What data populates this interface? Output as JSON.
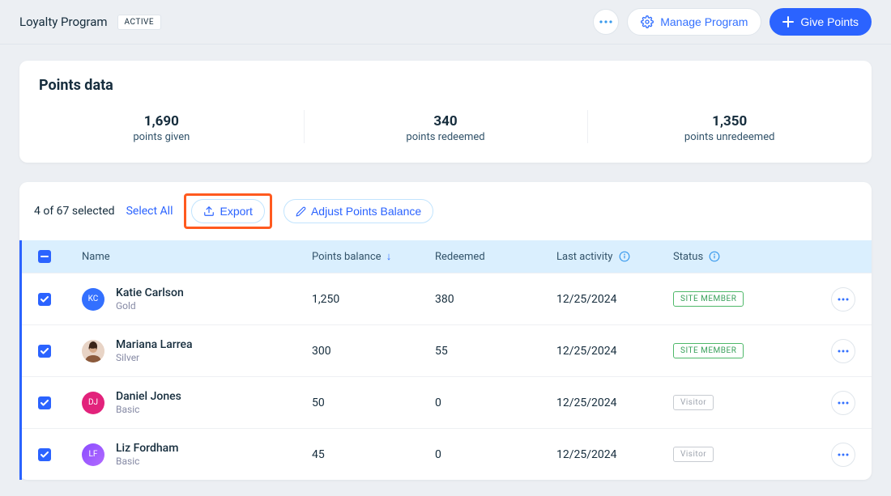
{
  "header": {
    "title": "Loyalty Program",
    "status_badge": "ACTIVE",
    "manage_button": "Manage Program",
    "give_button": "Give Points"
  },
  "summary": {
    "title": "Points data",
    "stats": [
      {
        "value": "1,690",
        "label": "points given"
      },
      {
        "value": "340",
        "label": "points redeemed"
      },
      {
        "value": "1,350",
        "label": "points unredeemed"
      }
    ]
  },
  "toolbar": {
    "selected_text": "4 of 67 selected",
    "select_all": "Select All",
    "export_label": "Export",
    "adjust_label": "Adjust Points Balance"
  },
  "columns": {
    "name": "Name",
    "balance": "Points balance",
    "redeemed": "Redeemed",
    "activity": "Last activity",
    "status": "Status"
  },
  "status_labels": {
    "member": "SITE MEMBER",
    "visitor": "Visitor"
  },
  "rows": [
    {
      "initials": "KC",
      "name": "Katie Carlson",
      "tier": "Gold",
      "balance": "1,250",
      "redeemed": "380",
      "activity": "12/25/2024",
      "status": "member",
      "avatar_class": "avatar-kc"
    },
    {
      "initials": "",
      "name": "Mariana Larrea",
      "tier": "Silver",
      "balance": "300",
      "redeemed": "55",
      "activity": "12/25/2024",
      "status": "member",
      "avatar_class": "avatar-ml"
    },
    {
      "initials": "DJ",
      "name": "Daniel Jones",
      "tier": "Basic",
      "balance": "50",
      "redeemed": "0",
      "activity": "12/25/2024",
      "status": "visitor",
      "avatar_class": "avatar-dj"
    },
    {
      "initials": "LF",
      "name": "Liz Fordham",
      "tier": "Basic",
      "balance": "45",
      "redeemed": "0",
      "activity": "12/25/2024",
      "status": "visitor",
      "avatar_class": "avatar-lf"
    }
  ]
}
